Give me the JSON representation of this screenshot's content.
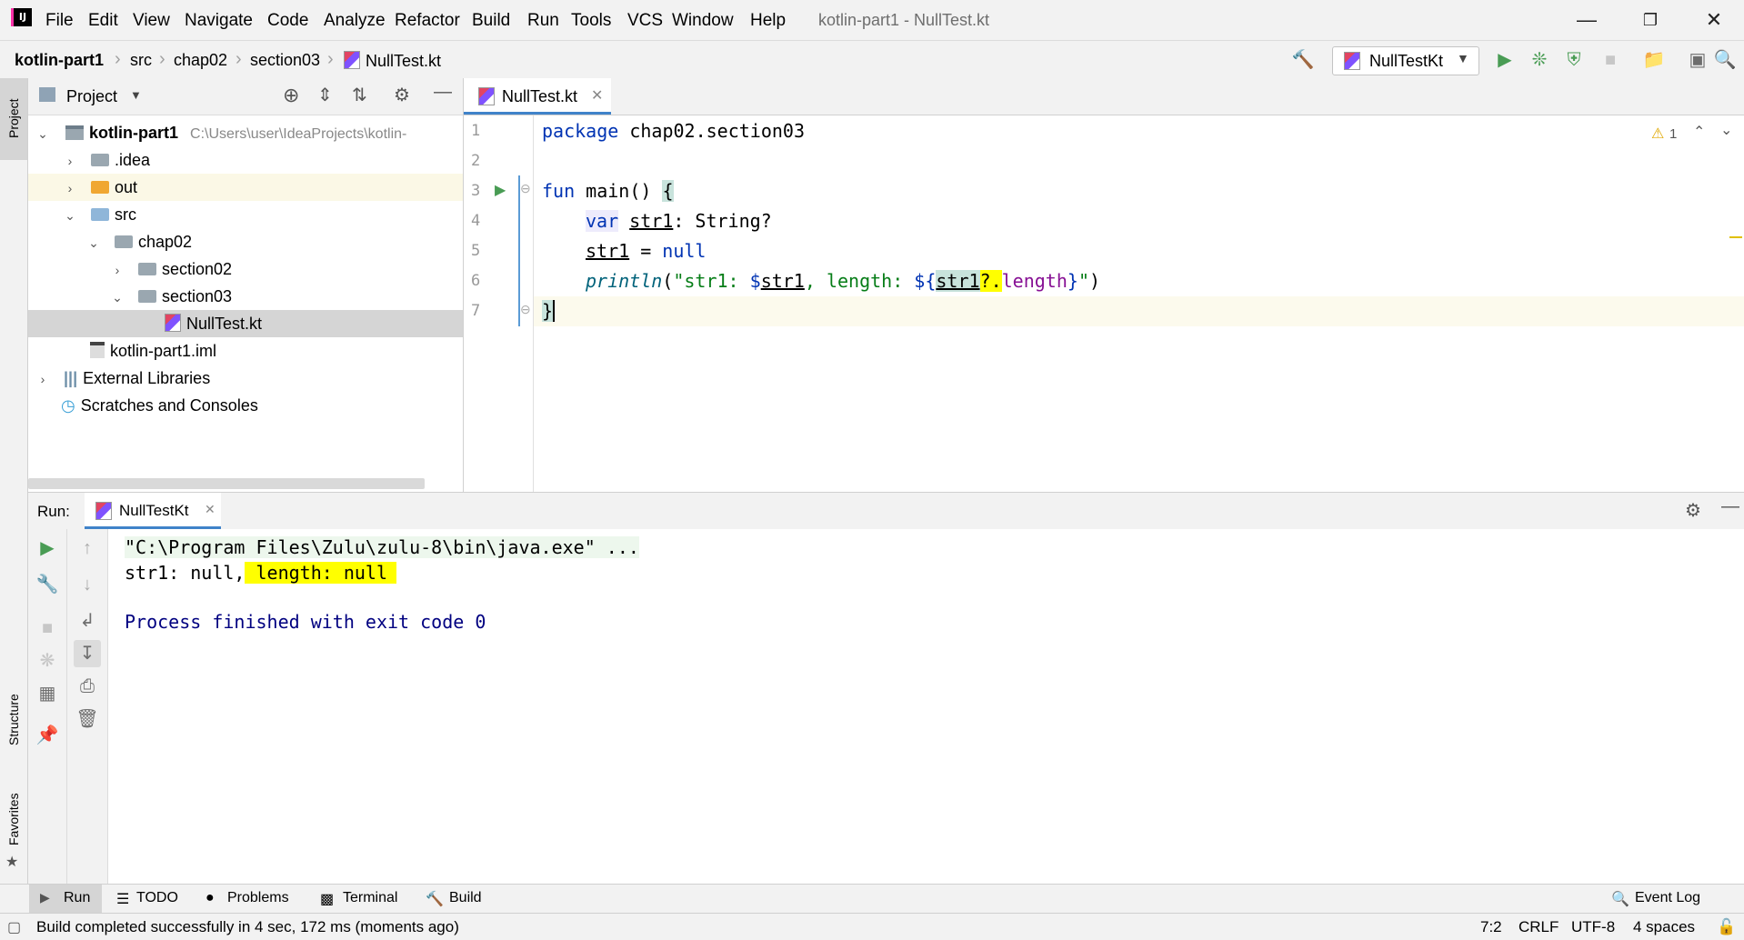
{
  "window": {
    "title": "kotlin-part1 - NullTest.kt",
    "menu": [
      "File",
      "Edit",
      "View",
      "Navigate",
      "Code",
      "Analyze",
      "Refactor",
      "Build",
      "Run",
      "Tools",
      "VCS",
      "Window",
      "Help"
    ]
  },
  "breadcrumb": [
    "kotlin-part1",
    "src",
    "chap02",
    "section03",
    "NullTest.kt"
  ],
  "run_config": "NullTestKt",
  "left_stripe": {
    "project": "Project",
    "structure": "Structure",
    "favorites": "Favorites"
  },
  "project_panel": {
    "title": "Project",
    "root_name": "kotlin-part1",
    "root_path": "C:\\Users\\user\\IdeaProjects\\kotlin-",
    "items": [
      {
        "label": ".idea"
      },
      {
        "label": "out"
      },
      {
        "label": "src"
      },
      {
        "label": "chap02"
      },
      {
        "label": "section02"
      },
      {
        "label": "section03"
      },
      {
        "label": "NullTest.kt"
      },
      {
        "label": "kotlin-part1.iml"
      },
      {
        "label": "External Libraries"
      },
      {
        "label": "Scratches and Consoles"
      }
    ]
  },
  "editor": {
    "tab": "NullTest.kt",
    "warning_count": "1",
    "line_numbers": [
      "1",
      "2",
      "3",
      "4",
      "5",
      "6",
      "7"
    ],
    "code": {
      "l1_kw": "package",
      "l1_rest": " chap02.section03",
      "l3_kw": "fun",
      "l3_rest": " main() ",
      "l3_brace": "{",
      "l4_kw": "var",
      "l4_var": "str1",
      "l4_rest": ": String?",
      "l5_var": "str1",
      "l5_op": " = ",
      "l5_null": "null",
      "l6_fn": "println",
      "l6_paren": "(",
      "l6_str_a": "\"str1: ",
      "l6_tpl1": "$",
      "l6_var1": "str1",
      "l6_str_b": ", length: ",
      "l6_tpl2": "${",
      "l6_var2": "str1",
      "l6_safe": "?.",
      "l6_len": "length",
      "l6_tpl_end": "}",
      "l6_str_c": "\"",
      "l6_close": ")",
      "l7_brace": "}"
    }
  },
  "run_panel": {
    "label": "Run:",
    "tab": "NullTestKt",
    "console": {
      "cmd": "\"C:\\Program Files\\Zulu\\zulu-8\\bin\\java.exe\" ...",
      "out_a": "str1: null,",
      "out_b": " length: null",
      "finished": "Process finished with exit code 0"
    }
  },
  "bottom_tools": [
    "Run",
    "TODO",
    "Problems",
    "Terminal",
    "Build"
  ],
  "event_log": "Event Log",
  "status": {
    "message": "Build completed successfully in 4 sec, 172 ms (moments ago)",
    "position": "7:2",
    "line_sep": "CRLF",
    "encoding": "UTF-8",
    "indent": "4 spaces"
  },
  "colors": {
    "accent": "#4083c9",
    "run_green": "#499c54",
    "highlight": "#ffff00",
    "keyword": "#0033b3"
  }
}
